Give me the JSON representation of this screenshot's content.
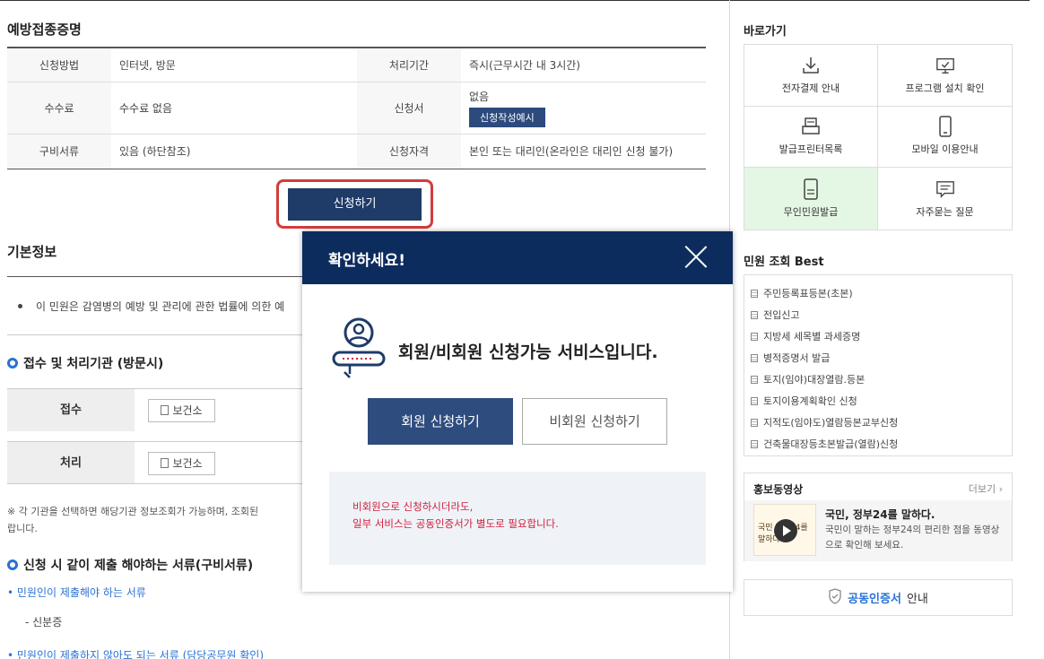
{
  "sections": {
    "vaccination_cert": "예방접종증명",
    "basic_info": "기본정보",
    "org_heading": "접수 및 처리기관 (방문시)",
    "docs_heading": "신청 시 같이 제출 해야하는 서류(구비서류)"
  },
  "info_table": {
    "method_label": "신청방법",
    "method_value": "인터넷, 방문",
    "period_label": "처리기간",
    "period_value": "즉시(근무시간 내 3시간)",
    "fee_label": "수수료",
    "fee_value": "수수료 없음",
    "form_label": "신청서",
    "form_value": "없음",
    "form_button": "신청작성예시",
    "docs_label": "구비서류",
    "docs_value": "있음 (하단참조)",
    "qual_label": "신청자격",
    "qual_value": "본인 또는 대리인(온라인은 대리인 신청 불가)"
  },
  "apply_button": "신청하기",
  "basic_bullet": "이 민원은 감염병의 예방 및 관리에 관한 법률에 의한 예",
  "org": {
    "receive_label": "접수",
    "receive_button": "보건소",
    "process_label": "처리",
    "process_button": "보건소"
  },
  "note": "※ 각 기관을 선택하면 해당기관 정보조회가 가능하며, 조회된 ",
  "note_line2": "랍니다.",
  "docs": {
    "link1": "• 민원인이 제출해야 하는 서류",
    "item1": "- 신분증",
    "link2": "• 민원인이 제출하지 않아도 되는 서류 (담당공무원 확인)"
  },
  "sidebar": {
    "quick_title": "바로가기",
    "quick_items": [
      {
        "label": "전자결제 안내",
        "icon": "download-icon"
      },
      {
        "label": "프로그램 설치 확인",
        "icon": "monitor-icon"
      },
      {
        "label": "발급프린터목록",
        "icon": "printer-icon"
      },
      {
        "label": "모바일 이용안내",
        "icon": "mobile-icon"
      },
      {
        "label": "무인민원발급",
        "icon": "kiosk-icon"
      },
      {
        "label": "자주묻는 질문",
        "icon": "chat-icon"
      }
    ],
    "best_title": "민원 조회 Best",
    "best_items": [
      "주민등록표등본(초본)",
      "전입신고",
      "지방세 세목별 과세증명",
      "병적증명서 발급",
      "토지(임야)대장열람.등본",
      "토지이용계획확인 신청",
      "지적도(임야도)열람등본교부신청",
      "건축물대장등초본발급(열람)신청"
    ],
    "promo_title": "홍보동영상",
    "promo_more": "더보기",
    "promo_video_title": "국민, 정부24를 말하다.",
    "promo_video_desc": "국민이 말하는 정부24의 편리한 점을 동영상으로 확인해 보세요.",
    "promo_thumb_text": "국민 정부24를 말하다",
    "cert_highlight": "공동인증서",
    "cert_rest": "안내"
  },
  "modal": {
    "title": "확인하세요!",
    "message": "회원/비회원 신청가능 서비스입니다.",
    "member_button": "회원 신청하기",
    "nonmember_button": "비회원 신청하기",
    "note_line1": "비회원으로 신청하시더라도,",
    "note_line2": "일부 서비스는 공동인증서가 별도로 필요합니다."
  },
  "colors": {
    "modal_header": "#0d2c5e",
    "primary_button": "#2f4c7e",
    "apply_highlight": "#d33c3c",
    "warning_text": "#d11e3b",
    "link_blue": "#2a72d4"
  }
}
